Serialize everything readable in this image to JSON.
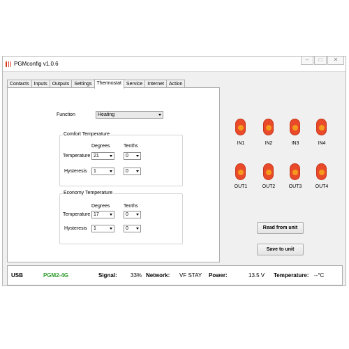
{
  "window": {
    "title": "PGMconfig v1.0.6"
  },
  "tabs": [
    "Contacts",
    "Inputs",
    "Outputs",
    "Settings",
    "Thermostat",
    "Service",
    "Internet",
    "Action"
  ],
  "active_tab": "Thermostat",
  "thermostat": {
    "function_label": "Function",
    "function_value": "Heating",
    "comfort": {
      "title": "Comfort Temperature",
      "degrees_label": "Degrees",
      "tenths_label": "Tenths",
      "temperature_label": "Temperature",
      "temperature_degrees": "21",
      "temperature_tenths": "0",
      "hysteresis_label": "Hysteresis",
      "hysteresis_degrees": "1",
      "hysteresis_tenths": "0"
    },
    "economy": {
      "title": "Economy Temperature",
      "degrees_label": "Degrees",
      "tenths_label": "Tenths",
      "temperature_label": "Temperature",
      "temperature_degrees": "17",
      "temperature_tenths": "0",
      "hysteresis_label": "Hysteresis",
      "hysteresis_degrees": "1",
      "hysteresis_tenths": "0"
    }
  },
  "indicators": {
    "inputs": [
      "IN1",
      "IN2",
      "IN3",
      "IN4"
    ],
    "outputs": [
      "OUT1",
      "OUT2",
      "OUT3",
      "OUT4"
    ],
    "led_color": "#e84a2a"
  },
  "buttons": {
    "read": "Read from unit",
    "save": "Save to unit"
  },
  "status": {
    "connection": "USB",
    "device": "PGM2-4G",
    "signal_label": "Signal:",
    "signal_value": "33%",
    "network_label": "Network:",
    "network_value": "VF STAY",
    "power_label": "Power:",
    "power_value": "13.5 V",
    "temperature_label": "Temperature:",
    "temperature_value": "--°C"
  }
}
